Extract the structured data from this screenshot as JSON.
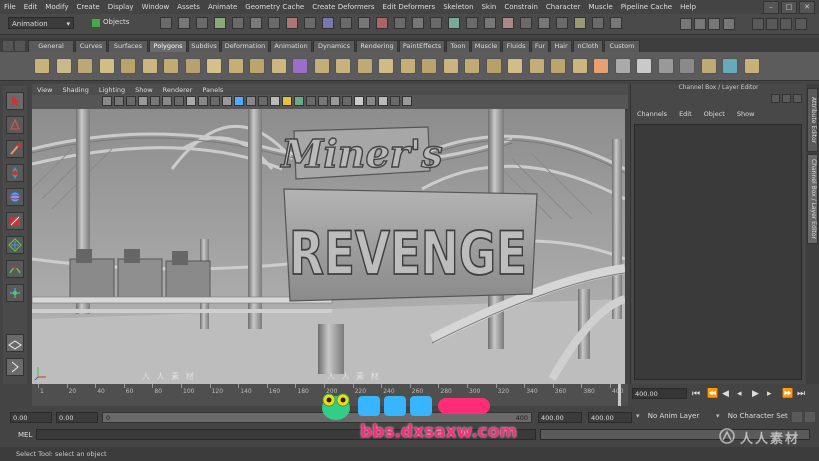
{
  "menubar": [
    "File",
    "Edit",
    "Modify",
    "Create",
    "Display",
    "Window",
    "Assets",
    "Animate",
    "Geometry Cache",
    "Create Deformers",
    "Edit Deformers",
    "Skeleton",
    "Skin",
    "Constrain",
    "Character",
    "Muscle",
    "Pipeline Cache",
    "Help"
  ],
  "statusline": {
    "mode": "Animation",
    "objects_label": "Objects"
  },
  "shelf_tabs": [
    "General",
    "Curves",
    "Surfaces",
    "Polygons",
    "Subdivs",
    "Deformation",
    "Animation",
    "Dynamics",
    "Rendering",
    "PaintEffects",
    "Toon",
    "Muscle",
    "Fluids",
    "Fur",
    "Hair",
    "nCloth",
    "Custom"
  ],
  "shelf_active": "Polygons",
  "view_menu": [
    "View",
    "Shading",
    "Lighting",
    "Show",
    "Renderer",
    "Panels"
  ],
  "channel_box": {
    "title": "Channel Box / Layer Editor",
    "menu": [
      "Channels",
      "Edit",
      "Object",
      "Show"
    ]
  },
  "side_tabs": [
    "Attribute Editor",
    "Channel Box / Layer Editor"
  ],
  "scene_sign": {
    "line1": "Miner's",
    "line2": "REVENGE"
  },
  "time_ticks": [
    "1",
    "20",
    "40",
    "60",
    "80",
    "100",
    "120",
    "140",
    "160",
    "180",
    "200",
    "220",
    "240",
    "260",
    "280",
    "300",
    "320",
    "340",
    "360",
    "380",
    "400"
  ],
  "current_time": "400.00",
  "range": {
    "start_outer": "0.00",
    "start_inner": "0.00",
    "slider_start": "0",
    "slider_end": "400",
    "end_inner": "400.00",
    "end_outer": "400.00"
  },
  "anim_layer": "No Anim Layer",
  "character_set": "No Character Set",
  "cmd_label": "MEL",
  "help_line": "Select Tool: select an object",
  "watermarks": {
    "dx": "bbs.dxsaxw.com",
    "rr": "人人素材",
    "rr_small": "人 人 素 材"
  }
}
